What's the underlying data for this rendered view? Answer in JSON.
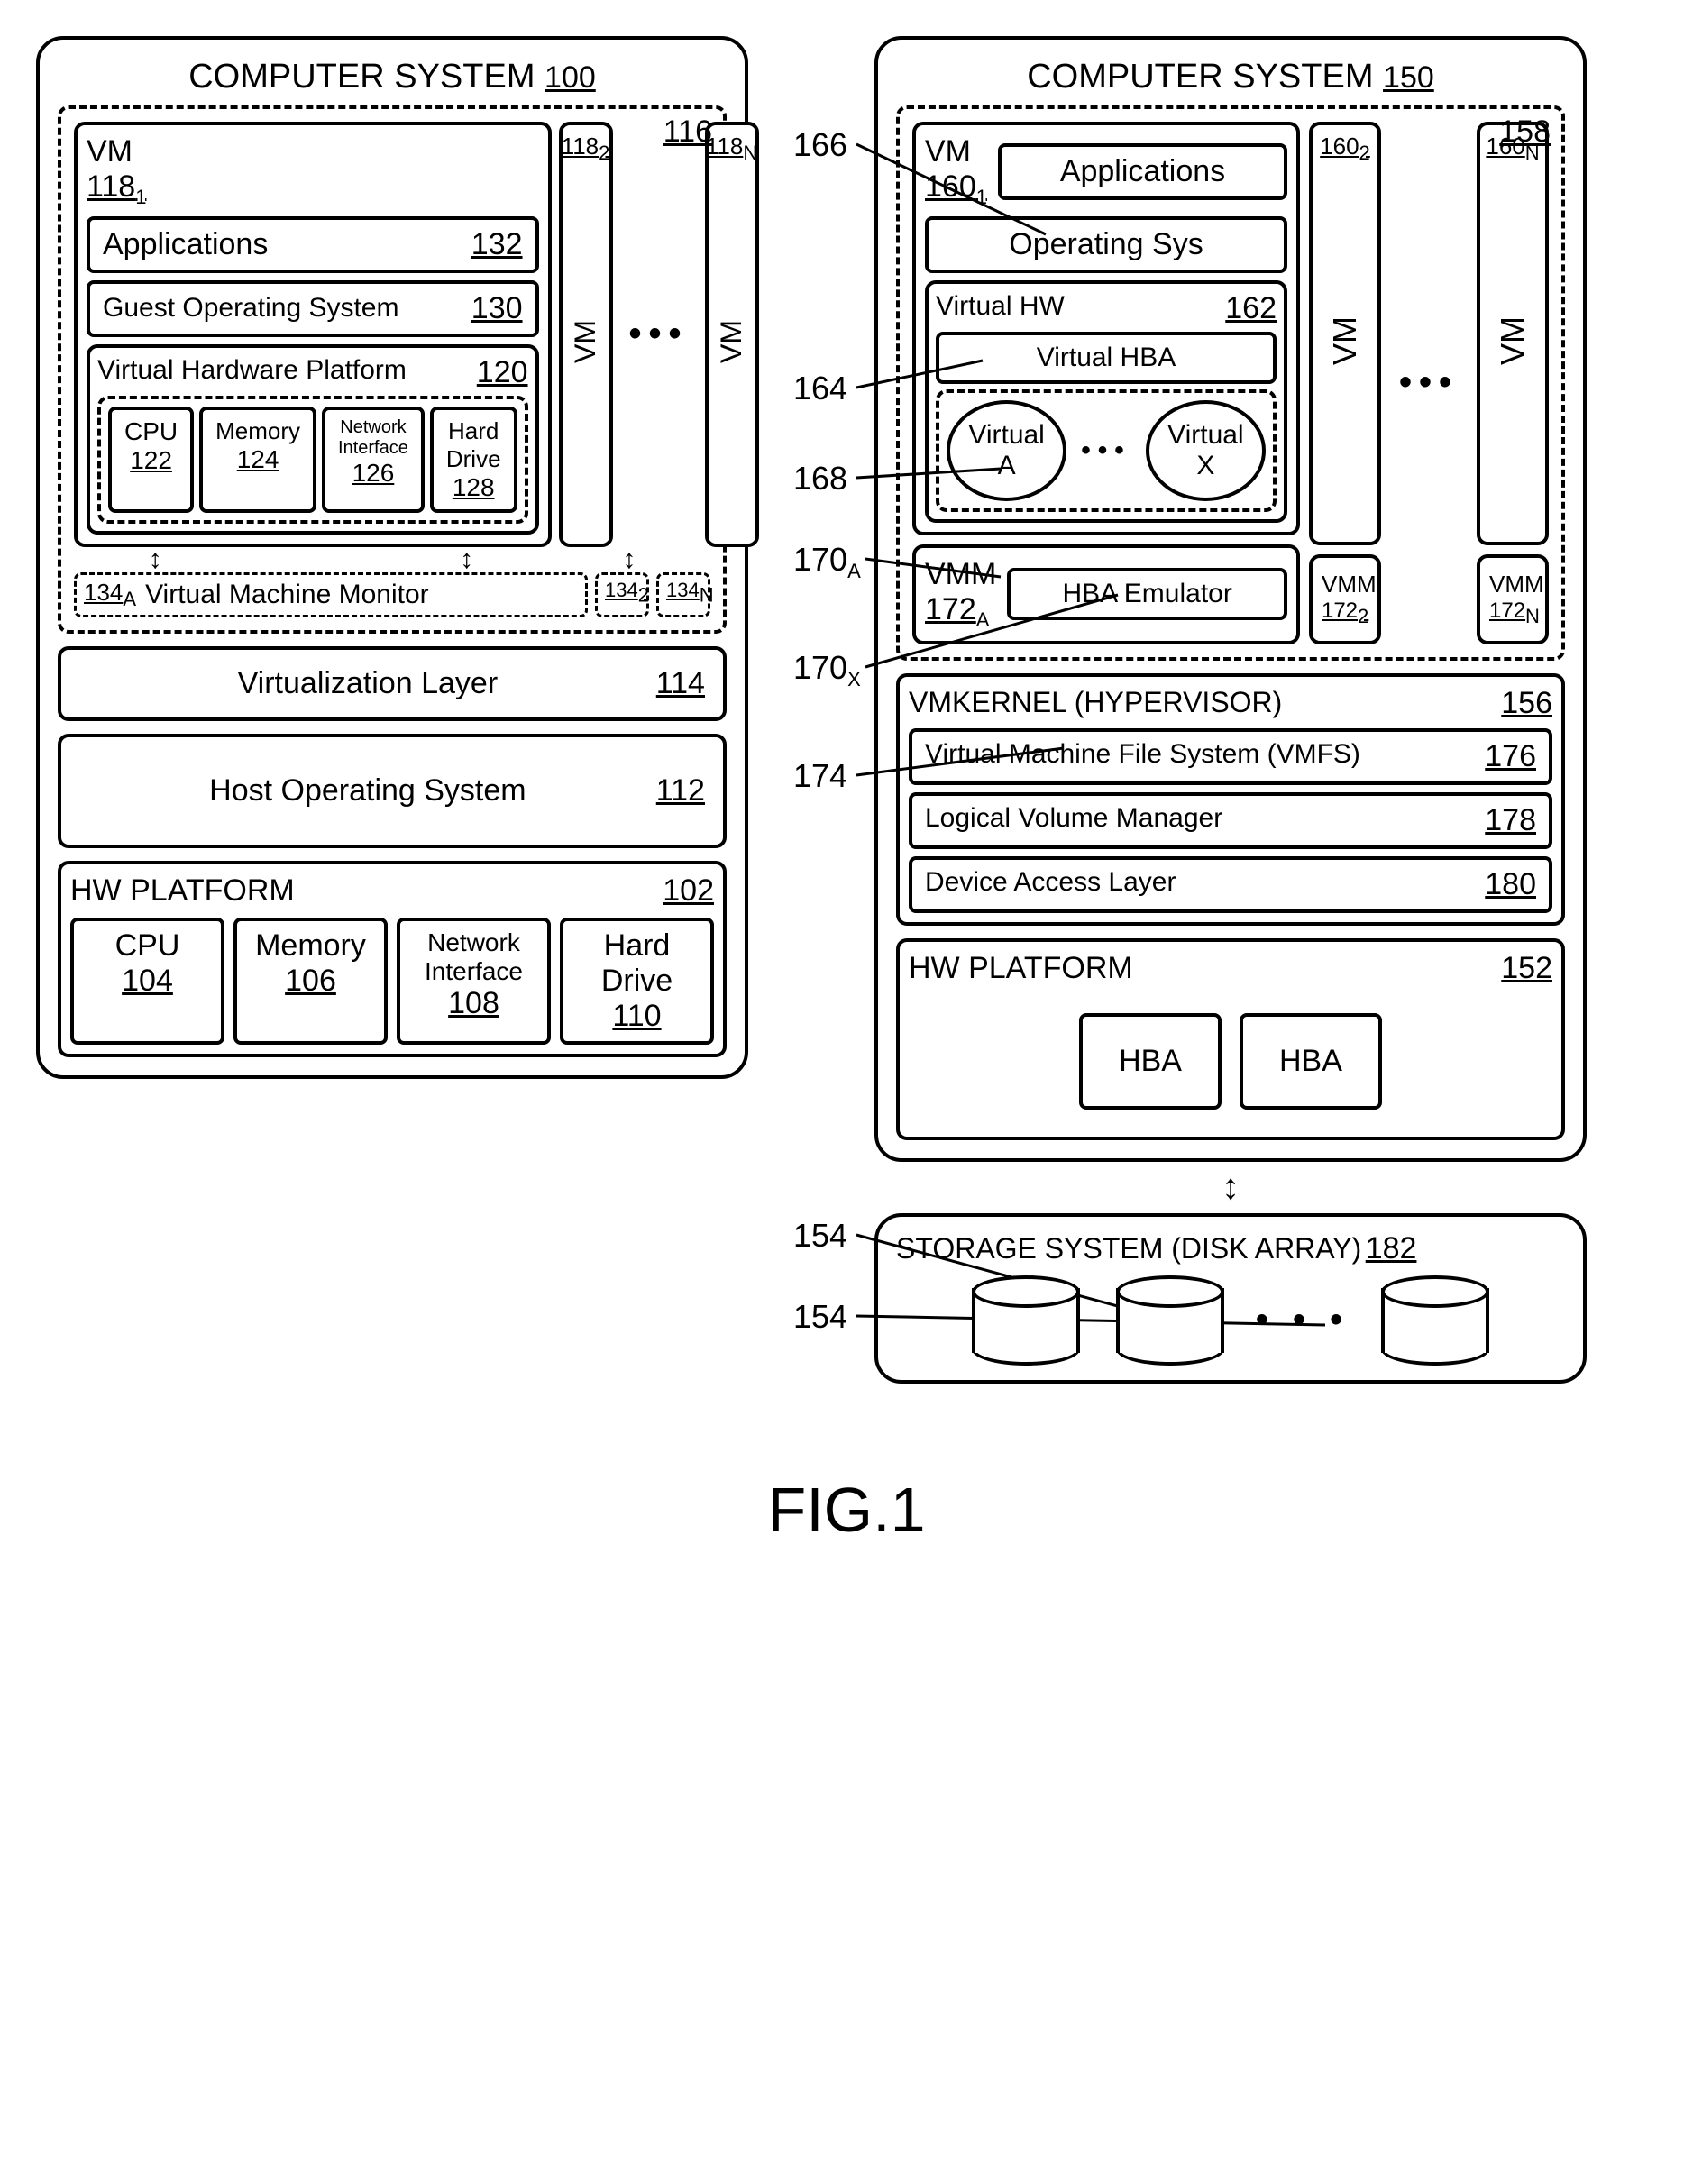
{
  "figure_label": "FIG.1",
  "left": {
    "title": "COMPUTER SYSTEM",
    "title_ref": "100",
    "execution_space_ref": "116",
    "vm": {
      "label": "VM",
      "ref1": "118",
      "sub1": "1",
      "applications": "Applications",
      "applications_ref": "132",
      "guest_os": "Guest Operating System",
      "guest_os_ref": "130",
      "vhp": "Virtual Hardware Platform",
      "vhp_ref": "120",
      "cpu": "CPU",
      "cpu_ref": "122",
      "memory": "Memory",
      "memory_ref": "124",
      "net": "Network Interface",
      "net_ref": "126",
      "hd": "Hard Drive",
      "hd_ref": "128"
    },
    "vm2_ref": "118",
    "vm2_sub": "2",
    "vmn_ref": "118",
    "vmn_sub": "N",
    "vm_label": "VM",
    "vmm_a": "134",
    "vmm_a_sub": "A",
    "vmm_label": "Virtual Machine Monitor",
    "vmm_2": "134",
    "vmm_2_sub": "2",
    "vmm_n": "134",
    "vmm_n_sub": "N",
    "virt_layer": "Virtualization Layer",
    "virt_layer_ref": "114",
    "host_os": "Host Operating System",
    "host_os_ref": "112",
    "hw_platform": "HW PLATFORM",
    "hw_platform_ref": "102",
    "hw_cpu": "CPU",
    "hw_cpu_ref": "104",
    "hw_memory": "Memory",
    "hw_memory_ref": "106",
    "hw_net": "Network Interface",
    "hw_net_ref": "108",
    "hw_hd": "Hard Drive",
    "hw_hd_ref": "110"
  },
  "callouts": {
    "c166": "166",
    "c164": "164",
    "c168": "168",
    "c170a": "170",
    "c170a_sub": "A",
    "c170x": "170",
    "c170x_sub": "X",
    "c174": "174",
    "c154a": "154",
    "c154b": "154"
  },
  "right": {
    "title": "COMPUTER SYSTEM",
    "title_ref": "150",
    "execution_space_ref": "158",
    "vm": {
      "label": "VM",
      "ref1": "160",
      "sub1": "1",
      "applications": "Applications",
      "os": "Operating Sys",
      "vhw": "Virtual HW",
      "vhw_ref": "162",
      "vhba": "Virtual HBA",
      "virtual_a": "Virtual A",
      "virtual_x": "Virtual X",
      "ellipsis": "..."
    },
    "vmm": "VMM",
    "vmm_ref1": "172",
    "vmm_sub1": "A",
    "hba_emu": "HBA Emulator",
    "vm_label": "VM",
    "vm2_ref": "160",
    "vm2_sub": "2",
    "vmn_ref": "160",
    "vmn_sub": "N",
    "vmm2_ref": "172",
    "vmm2_sub": "2",
    "vmmn_ref": "172",
    "vmmn_sub": "N",
    "vmkernel": "VMKERNEL (HYPERVISOR)",
    "vmkernel_ref": "156",
    "vmfs": "Virtual Machine File System (VMFS)",
    "vmfs_ref": "176",
    "lvm": "Logical Volume Manager",
    "lvm_ref": "178",
    "dal": "Device Access Layer",
    "dal_ref": "180",
    "hw_platform": "HW PLATFORM",
    "hw_platform_ref": "152",
    "hba": "HBA",
    "storage": "STORAGE SYSTEM (DISK ARRAY)",
    "storage_ref": "182"
  }
}
